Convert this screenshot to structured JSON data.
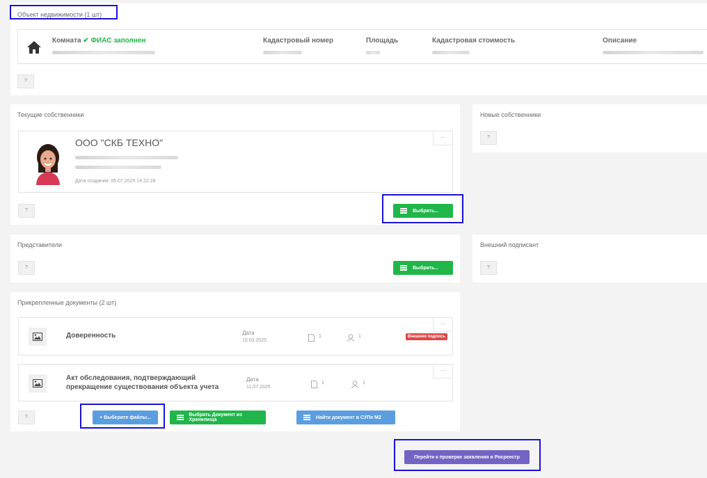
{
  "property": {
    "title": "Объект недвижимости (1 шт)",
    "type_label": "Комната",
    "fias_check": "✔",
    "fias_status": "ФИАС заполнен",
    "columns": [
      "Кадастровый номер",
      "Площадь",
      "Кадастровая стоимость",
      "Описание"
    ],
    "help_label": "?"
  },
  "current_owners": {
    "title": "Текущие собственники",
    "owner_name": "ООО \"СКБ ТЕХНО\"",
    "created_label": "Дата создания: 05.07.2025 14:22:28",
    "menu_label": "...",
    "help_label": "?",
    "select_label": "Выбрать..."
  },
  "new_owners": {
    "title": "Новые собственники",
    "help_label": "?"
  },
  "representatives": {
    "title": "Представители",
    "help_label": "?",
    "select_label": "Выбрать..."
  },
  "external_signer": {
    "title": "Внешний подписант",
    "help_label": "?"
  },
  "documents": {
    "title": "Прикрепленные документы (2 шт)",
    "items": [
      {
        "name": "Доверенность",
        "date_label": "Дата",
        "date": "10.03.2025",
        "pages": "1",
        "signers": "1",
        "badge": "Внешняя подпись",
        "menu": "..."
      },
      {
        "name": "Акт обследования, подтверждающий прекращение существования объекта учета",
        "date_label": "Дата",
        "date": "11.07.2025",
        "pages": "1",
        "signers": "1",
        "menu": "..."
      }
    ],
    "help_label": "?",
    "choose_files_label": "Выберите файлы...",
    "choose_files_plus": "+",
    "from_storage_label": "Выбрать Документ из Хранилища",
    "find_suvp_label": "Найти документ в СУПе М2"
  },
  "submit": {
    "label": "Перейти к проверке заявления в Росреестр"
  },
  "colors": {
    "green": "#20b64a",
    "blue": "#5b9ee0",
    "purple": "#7263c4",
    "red": "#e04848",
    "highlight": "#1a10d6"
  }
}
